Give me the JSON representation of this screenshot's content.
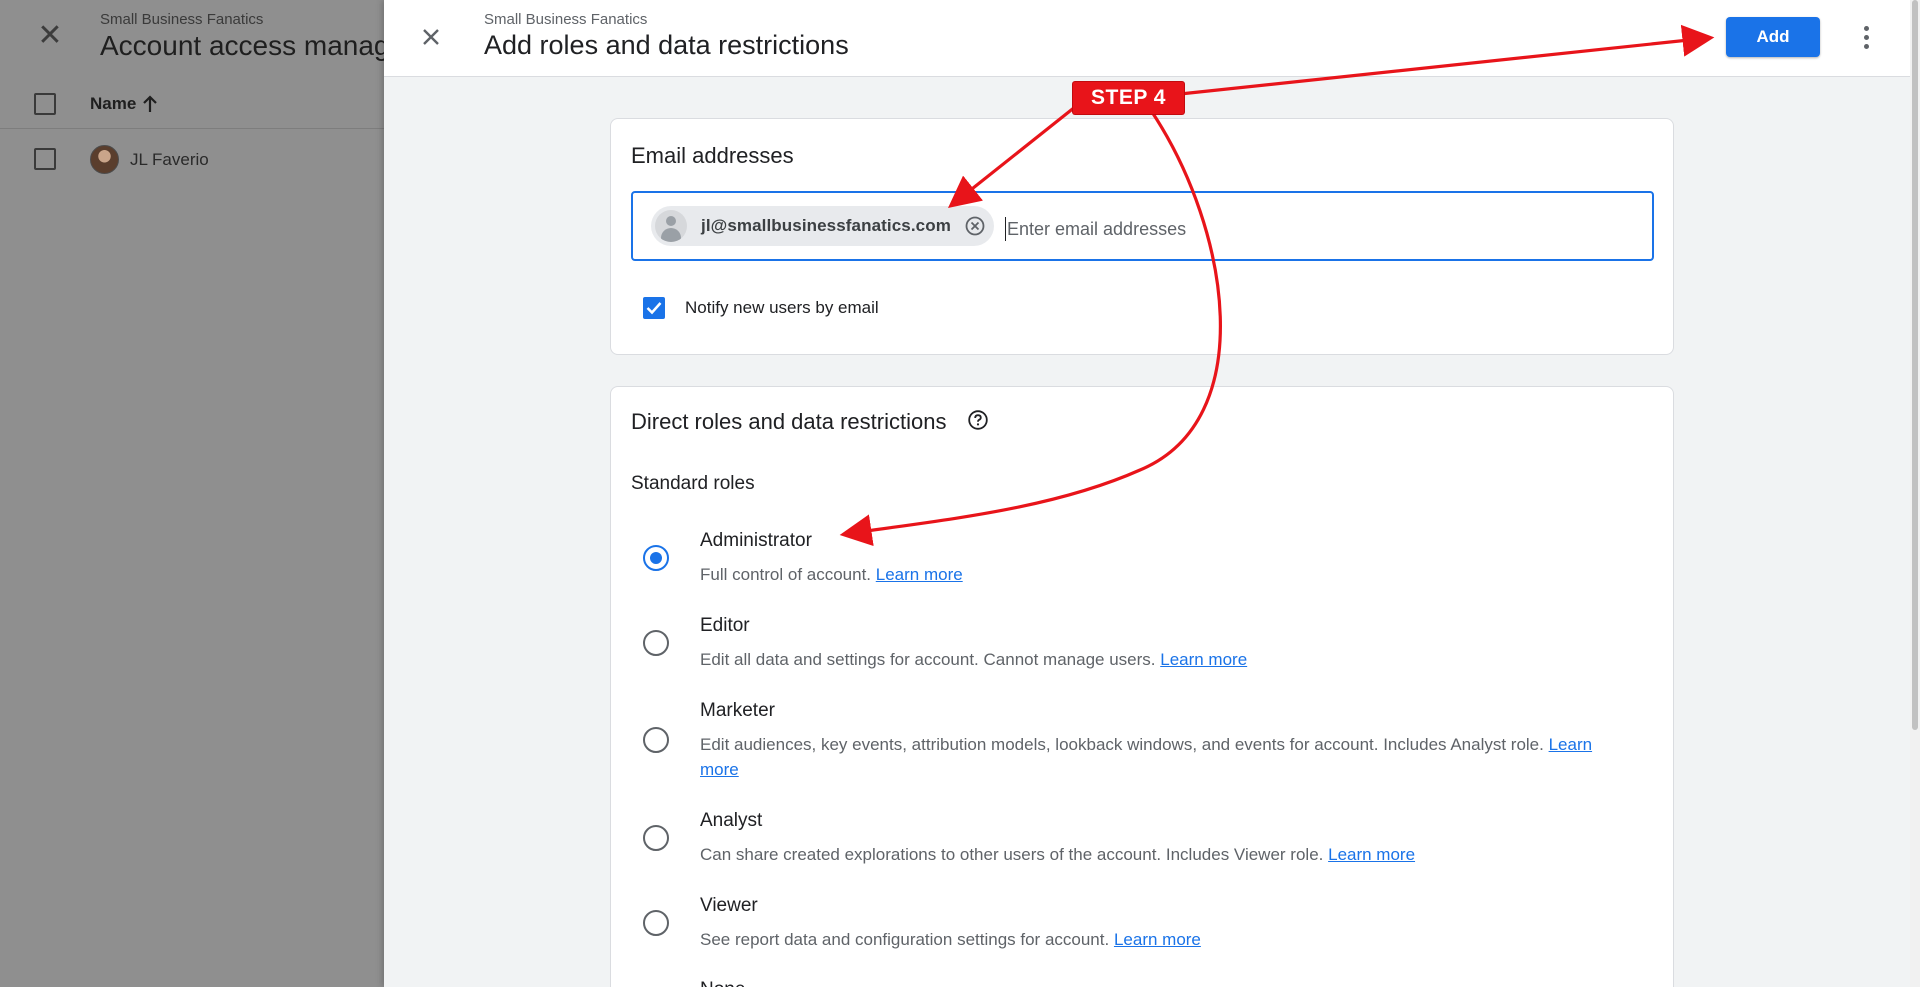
{
  "background": {
    "subtitle": "Small Business Fanatics",
    "title": "Account access manag",
    "column_header": "Name",
    "rows": [
      {
        "name": "JL Faverio"
      }
    ]
  },
  "panel": {
    "subtitle": "Small Business Fanatics",
    "title": "Add roles and data restrictions",
    "add_label": "Add"
  },
  "email_card": {
    "title": "Email addresses",
    "chip_email": "jl@smallbusinessfanatics.com",
    "input_placeholder": "Enter email addresses",
    "notify_label": "Notify new users by email",
    "notify_checked": true
  },
  "roles_card": {
    "title": "Direct roles and data restrictions",
    "section_label": "Standard roles",
    "selected": "Administrator",
    "roles": [
      {
        "name": "Administrator",
        "desc": "Full control of account.",
        "link": "Learn more"
      },
      {
        "name": "Editor",
        "desc": "Edit all data and settings for account. Cannot manage users.",
        "link": "Learn more"
      },
      {
        "name": "Marketer",
        "desc": "Edit audiences, key events, attribution models, lookback windows, and events for account. Includes Analyst role.",
        "link": "Learn more"
      },
      {
        "name": "Analyst",
        "desc": "Can share created explorations to other users of the account. Includes Viewer role.",
        "link": "Learn more"
      },
      {
        "name": "Viewer",
        "desc": "See report data and configuration settings for account.",
        "link": "Learn more"
      },
      {
        "name": "None",
        "desc": "",
        "link": ""
      }
    ]
  },
  "annotation": {
    "label": "STEP 4",
    "color": "#e8141a"
  },
  "colors": {
    "accent": "#1a73e8",
    "overlay": "#8f8f8f"
  }
}
